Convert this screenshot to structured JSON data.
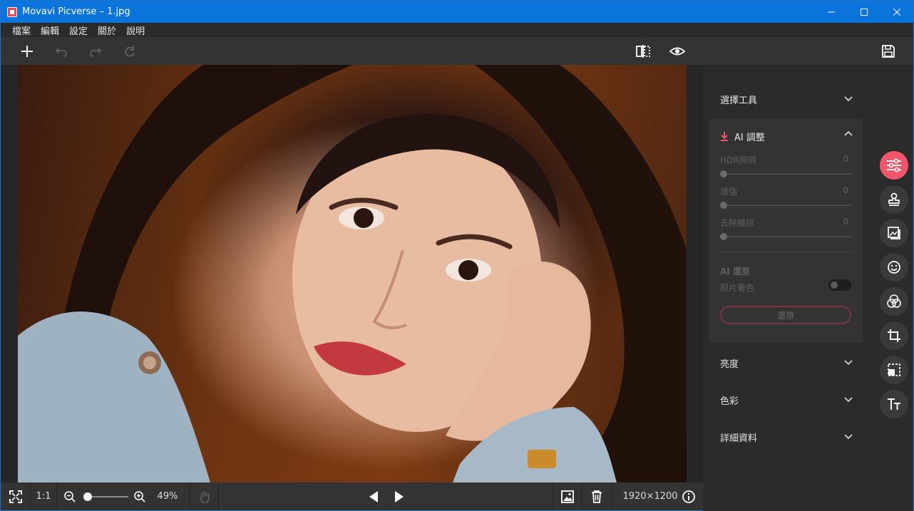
{
  "window": {
    "title": "Movavi Picverse – 1.jpg"
  },
  "menu": [
    "檔案",
    "編輯",
    "設定",
    "關於",
    "說明"
  ],
  "toolbar": {
    "add": "add-icon",
    "undo": "undo-icon",
    "redo": "redo-icon",
    "reset": "reset-icon",
    "compare": "compare-icon",
    "preview": "eye-icon",
    "save": "save-icon"
  },
  "bottom": {
    "ratio_label": "1:1",
    "zoom_percent": "49%",
    "zoom_level": 0.49,
    "image_size": "1920×1200"
  },
  "panel": {
    "select_tools": "選擇工具",
    "ai_adjust": {
      "title": "AI 調整",
      "sliders": [
        {
          "label": "HDR照明",
          "value": "0"
        },
        {
          "label": "增強",
          "value": "0"
        },
        {
          "label": "去除雜訊",
          "value": "0"
        }
      ],
      "restore_section": "AI 還原",
      "colorize_label": "照片著色",
      "restore_button": "還原"
    },
    "brightness": "亮度",
    "color": "色彩",
    "details": "詳細資料"
  },
  "colors": {
    "accent": "#f0566b",
    "titlebar": "#0a74da"
  }
}
